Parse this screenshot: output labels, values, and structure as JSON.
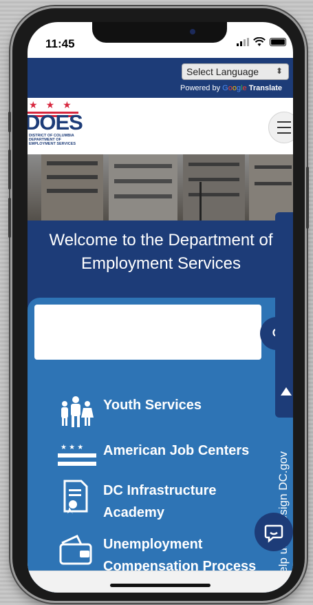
{
  "status_bar": {
    "time": "11:45"
  },
  "translate": {
    "select_language": "Select Language",
    "powered_by": "Powered by",
    "google": [
      "G",
      "o",
      "o",
      "g",
      "l",
      "e"
    ],
    "translate_label": "Translate"
  },
  "logo": {
    "wordmark": "DOES",
    "subtitle": "DISTRICT OF COLUMBIA DEPARTMENT OF EMPLOYMENT SERVICES"
  },
  "hero": {
    "title": "Welcome to the Department of Employment Services"
  },
  "search": {
    "button_label": "Q"
  },
  "services": [
    {
      "label": "Youth Services",
      "icon": "family-icon"
    },
    {
      "label": "American Job Centers",
      "icon": "dc-flag-icon"
    },
    {
      "label": "DC Infrastructure Academy",
      "icon": "certificate-icon"
    },
    {
      "label": "Unemployment Compensation Process",
      "icon": "wallet-icon"
    }
  ],
  "feedback_tab": {
    "label": "Help us redesign DC.gov"
  },
  "colors": {
    "navy": "#1d3c78",
    "panel_blue": "#2e74b5",
    "dc_red": "#d7263d"
  }
}
